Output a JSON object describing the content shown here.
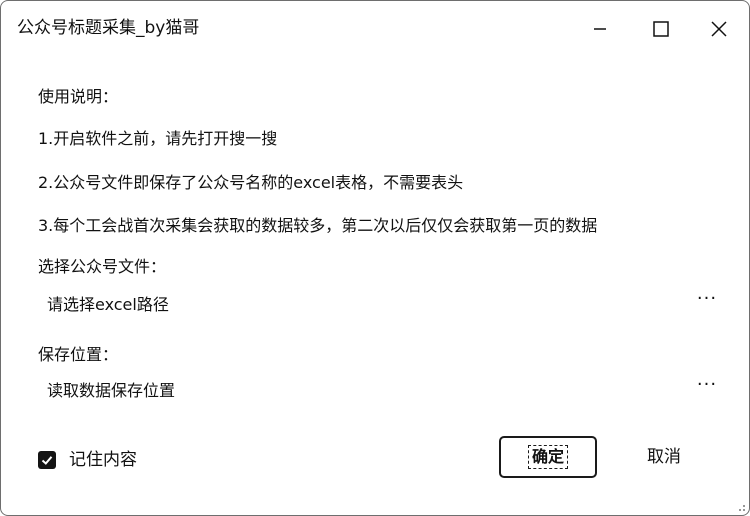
{
  "window": {
    "title": "公众号标题采集_by猫哥"
  },
  "controls": {
    "minimize_icon": "minimize-icon",
    "maximize_icon": "maximize-icon",
    "close_icon": "close-icon"
  },
  "instructions": {
    "heading": "使用说明：",
    "lines": [
      "1.开启软件之前，请先打开搜一搜",
      "2.公众号文件即保存了公众号名称的excel表格，不需要表头",
      "3.每个工会战首次采集会获取的数据较多，第二次以后仅仅会获取第一页的数据"
    ]
  },
  "file_select": {
    "label": "选择公众号文件：",
    "placeholder": "请选择excel路径",
    "browse_label": "···"
  },
  "save_location": {
    "label": "保存位置：",
    "placeholder": "读取数据保存位置",
    "browse_label": "···"
  },
  "remember": {
    "label": "记住内容",
    "checked": true
  },
  "buttons": {
    "ok": "确定",
    "cancel": "取消"
  }
}
